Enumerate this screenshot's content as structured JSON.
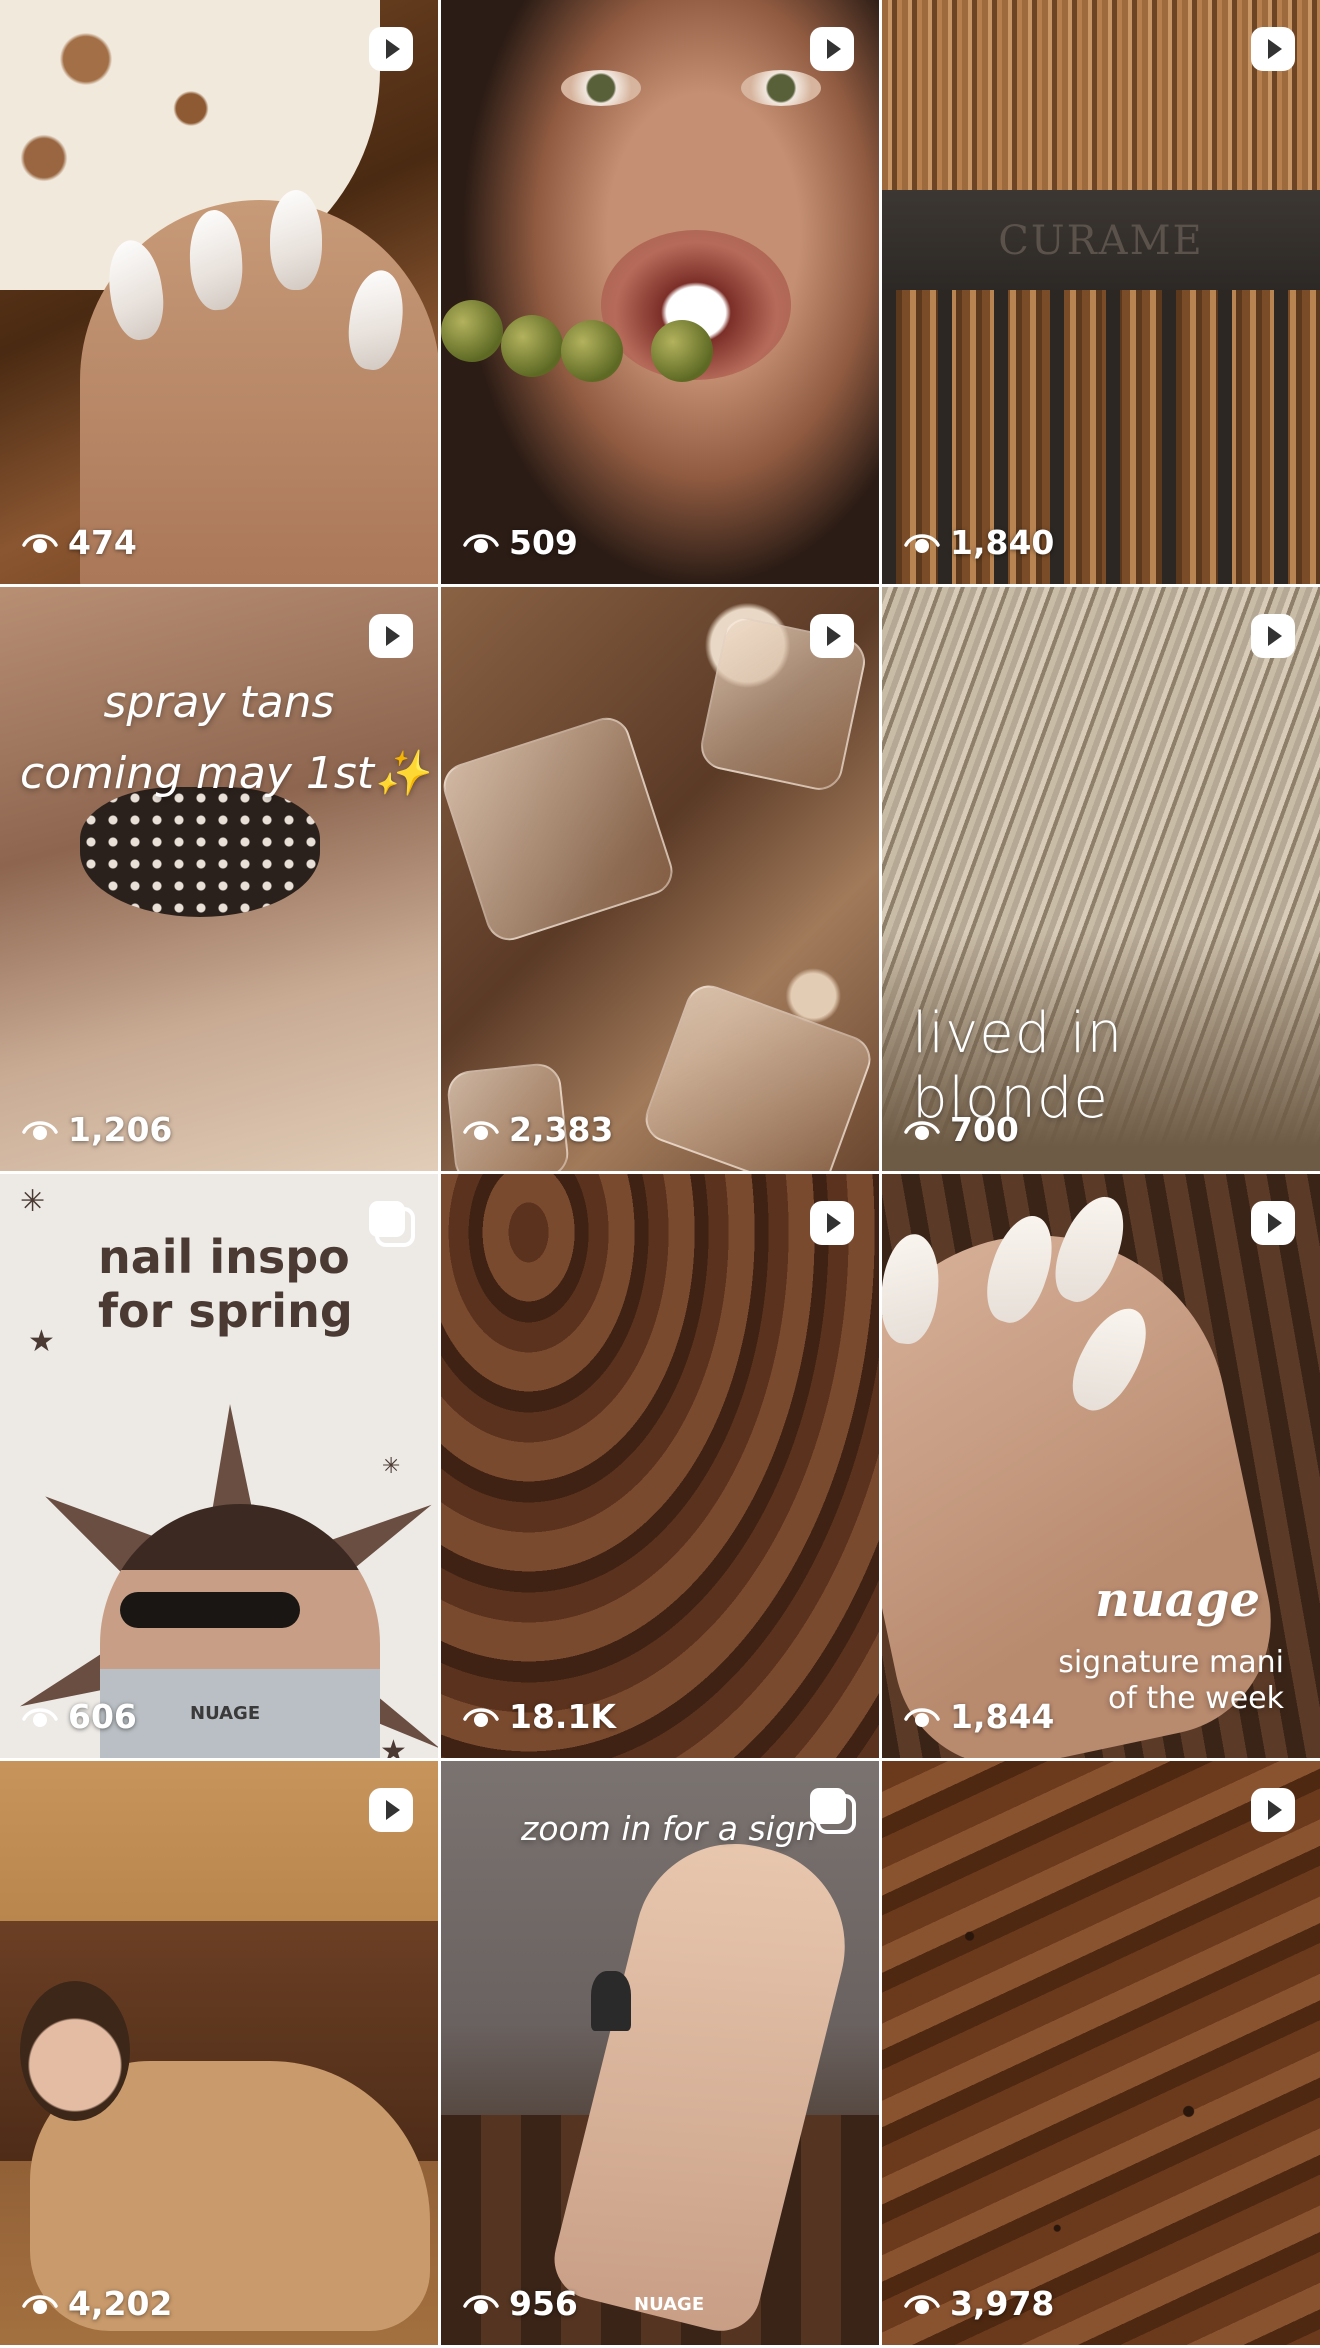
{
  "grid": {
    "tiles": [
      {
        "views": "474",
        "type": "reel"
      },
      {
        "views": "509",
        "type": "reel"
      },
      {
        "views": "1,840",
        "type": "reel",
        "overlay": "CURAME"
      },
      {
        "views": "1,206",
        "type": "reel",
        "overlay_line1": "spray tans",
        "overlay_line2": "coming may 1st✨"
      },
      {
        "views": "2,383",
        "type": "reel"
      },
      {
        "views": "700",
        "type": "reel",
        "overlay": "lived in blonde"
      },
      {
        "views": "606",
        "type": "carousel",
        "title_line1": "nail inspo",
        "title_line2": "for spring",
        "brand": "NUAGE"
      },
      {
        "views": "18.1K",
        "type": "reel"
      },
      {
        "views": "1,844",
        "type": "reel",
        "brand": "nuage",
        "caption_line1": "signature mani",
        "caption_line2": "of the week"
      },
      {
        "views": "4,202",
        "type": "reel"
      },
      {
        "views": "956",
        "type": "carousel",
        "overlay": "zoom in for a sign",
        "brand": "NUAGE"
      },
      {
        "views": "3,978",
        "type": "reel"
      }
    ]
  },
  "icons": {
    "views": "eye-icon",
    "reel": "reel-icon",
    "carousel": "carousel-icon"
  }
}
